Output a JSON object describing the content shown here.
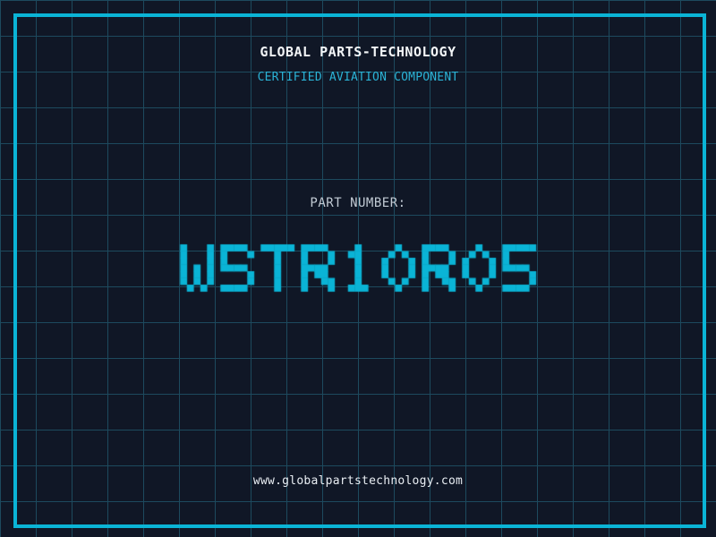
{
  "header": {
    "title": "GLOBAL PARTS-TECHNOLOGY",
    "subtitle": "CERTIFIED AVIATION COMPONENT"
  },
  "part": {
    "label": "PART NUMBER:",
    "value": "WSTR10R05"
  },
  "footer": {
    "website": "www.globalpartstechnology.com"
  },
  "colors": {
    "background": "#101726",
    "grid_line": "#1d4a5e",
    "accent_cyan": "#0ab4d6",
    "subtitle_cyan": "#2bb3d6",
    "title_white": "#f2f5f7",
    "label_gray": "#c2cbd4",
    "footer_white": "#e9eef3"
  }
}
